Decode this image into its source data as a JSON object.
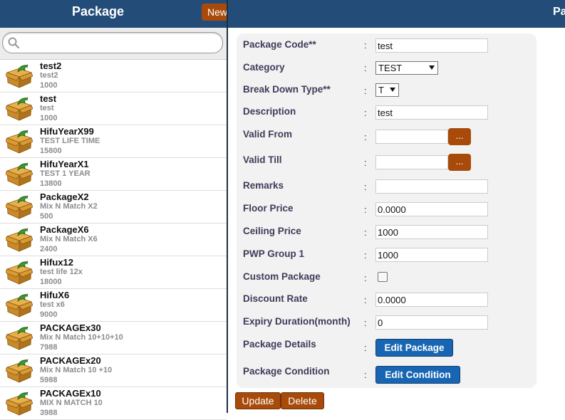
{
  "left_header": {
    "title": "Package",
    "new_label": "New"
  },
  "right_header": {
    "title": "Pa"
  },
  "search": {
    "placeholder": ""
  },
  "packages": [
    {
      "name": "test2",
      "desc": "test2",
      "price": "1000"
    },
    {
      "name": "test",
      "desc": "test",
      "price": "1000"
    },
    {
      "name": "HifuYearX99",
      "desc": "TEST LIFE TIME",
      "price": "15800"
    },
    {
      "name": "HifuYearX1",
      "desc": "TEST 1 YEAR",
      "price": "13800"
    },
    {
      "name": "PackageX2",
      "desc": "Mix N Match X2",
      "price": "500"
    },
    {
      "name": "PackageX6",
      "desc": "Mix N Match X6",
      "price": "2400"
    },
    {
      "name": "Hifux12",
      "desc": "test life 12x",
      "price": "18000"
    },
    {
      "name": "HifuX6",
      "desc": "test x6",
      "price": "9000"
    },
    {
      "name": "PACKAGEx30",
      "desc": "Mix N Match 10+10+10",
      "price": "7988"
    },
    {
      "name": "PACKAGEx20",
      "desc": "Mix N Match 10 +10",
      "price": "5988"
    },
    {
      "name": "PACKAGEx10",
      "desc": "MIX N MATCH 10",
      "price": "3988"
    }
  ],
  "form": {
    "colon": ":",
    "package_code": {
      "label": "Package Code**",
      "value": "test"
    },
    "category": {
      "label": "Category",
      "value": "TEST"
    },
    "break_down_type": {
      "label": "Break Down Type**",
      "value": "T"
    },
    "description": {
      "label": "Description",
      "value": "test"
    },
    "valid_from": {
      "label": "Valid From",
      "value": "",
      "button": "..."
    },
    "valid_till": {
      "label": "Valid Till",
      "value": "",
      "button": "..."
    },
    "remarks": {
      "label": "Remarks",
      "value": ""
    },
    "floor_price": {
      "label": "Floor Price",
      "value": "0.0000"
    },
    "ceiling_price": {
      "label": "Ceiling Price",
      "value": "1000"
    },
    "pwp_group": {
      "label": "PWP Group 1",
      "value": "1000"
    },
    "custom_package": {
      "label": "Custom Package",
      "checked": false
    },
    "discount_rate": {
      "label": "Discount Rate",
      "value": "0.0000"
    },
    "expiry_duration": {
      "label": "Expiry Duration(month)",
      "value": "0"
    },
    "package_details": {
      "label": "Package Details",
      "button": "Edit Package"
    },
    "package_condition": {
      "label": "Package Condition",
      "button": "Edit Condition"
    }
  },
  "actions": {
    "update": "Update",
    "delete": "Delete"
  },
  "colors": {
    "header": "#234d78",
    "orange_button": "#a84a0a",
    "blue_button": "#1866b3"
  }
}
